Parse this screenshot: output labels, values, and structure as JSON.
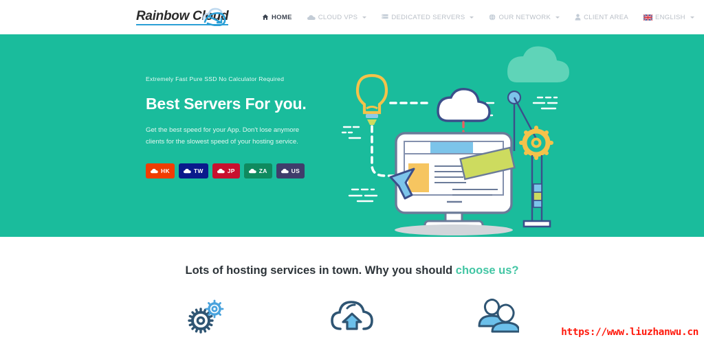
{
  "header": {
    "logo": {
      "text": "Rainbow Cloud",
      "icon": "cloud-swoosh-logo-icon"
    },
    "nav": [
      {
        "label": "HOME",
        "icon": "home-icon",
        "active": true,
        "caret": false
      },
      {
        "label": "CLOUD VPS",
        "icon": "cloud-icon",
        "active": false,
        "caret": true
      },
      {
        "label": "DEDICATED SERVERS",
        "icon": "server-icon",
        "active": false,
        "caret": true
      },
      {
        "label": "OUR NETWORK",
        "icon": "globe-icon",
        "active": false,
        "caret": true
      },
      {
        "label": "CLIENT AREA",
        "icon": "user-icon",
        "active": false,
        "caret": false
      },
      {
        "label": "ENGLISH",
        "icon": "uk-flag-icon",
        "active": false,
        "caret": true
      }
    ]
  },
  "hero": {
    "background_color": "#1abc9c",
    "eyebrow": "Extremely Fast Pure SSD No Calculator Required",
    "title": "Best Servers For you.",
    "subtitle": "Get the best speed for your App. Don't lose anymore clients for the slowest speed of your hosting service.",
    "locations": [
      {
        "code": "HK",
        "color": "#f03c02",
        "icon": "cloud-icon"
      },
      {
        "code": "TW",
        "color": "#0a1a8c",
        "icon": "cloud-icon"
      },
      {
        "code": "JP",
        "color": "#c8102e",
        "icon": "cloud-icon"
      },
      {
        "code": "ZA",
        "color": "#0f8a5f",
        "icon": "cloud-icon"
      },
      {
        "code": "US",
        "color": "#3f3d6b",
        "icon": "cloud-icon"
      }
    ],
    "illustration": "computer-cloud-hosting-illustration"
  },
  "features": {
    "heading_main": "Lots of hosting services in town. Why you should ",
    "heading_accent": "choose us?",
    "accent_color": "#43c6a4",
    "items": [
      {
        "icon": "gears-icon"
      },
      {
        "icon": "cloud-upload-icon"
      },
      {
        "icon": "users-icon"
      }
    ]
  },
  "watermark": {
    "url": "https://www.liuzhanwu.cn",
    "color": "#ff1a0d"
  }
}
